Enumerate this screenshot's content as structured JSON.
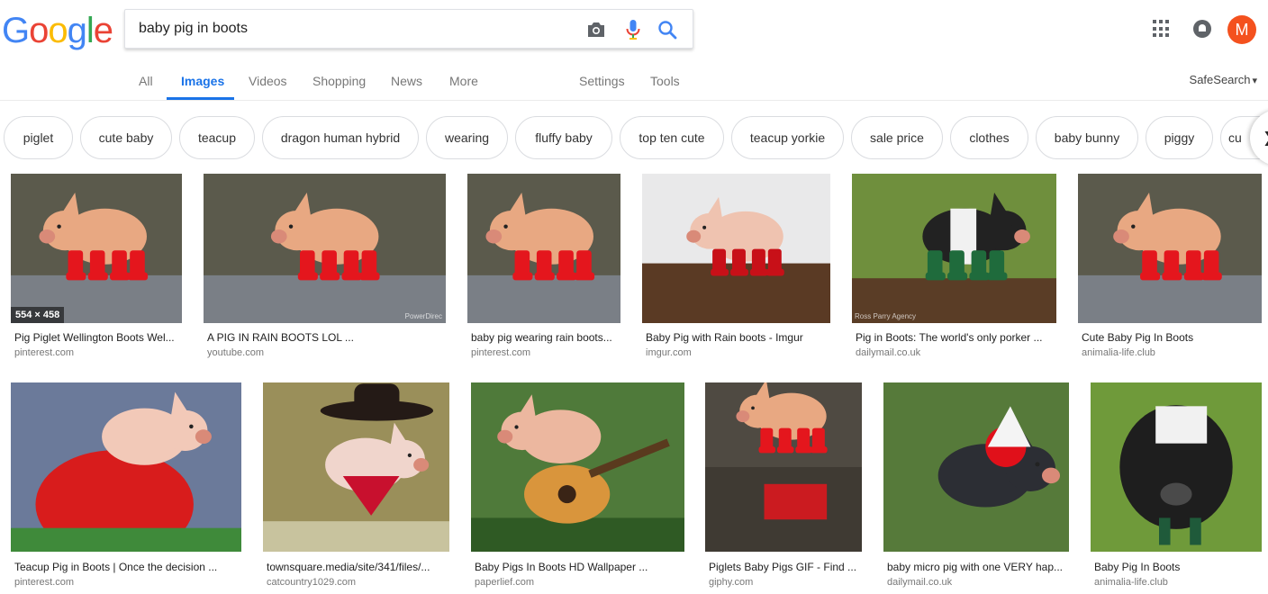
{
  "logo": [
    "G",
    "o",
    "o",
    "g",
    "l",
    "e"
  ],
  "search": {
    "query": "baby pig in boots"
  },
  "avatar_letter": "M",
  "tabs": [
    {
      "label": "All"
    },
    {
      "label": "Images"
    },
    {
      "label": "Videos"
    },
    {
      "label": "Shopping"
    },
    {
      "label": "News"
    },
    {
      "label": "More"
    },
    {
      "label": "Settings"
    },
    {
      "label": "Tools"
    }
  ],
  "safesearch_label": "SafeSearch",
  "chips": [
    "piglet",
    "cute baby",
    "teacup",
    "dragon human hybrid",
    "wearing",
    "fluffy baby",
    "top ten cute",
    "teacup yorkie",
    "sale price",
    "clothes",
    "baby bunny",
    "piggy",
    "cu"
  ],
  "results": [
    {
      "title": "Pig Piglet Wellington Boots Wel...",
      "domain": "pinterest.com",
      "dims": "554 × 458",
      "watermark": ""
    },
    {
      "title": "A PIG IN RAIN BOOTS LOL ...",
      "domain": "youtube.com",
      "watermark": "PowerDirec"
    },
    {
      "title": "baby pig wearing rain boots...",
      "domain": "pinterest.com"
    },
    {
      "title": "Baby Pig with Rain boots - Imgur",
      "domain": "imgur.com"
    },
    {
      "title": "Pig in Boots: The world's only porker ...",
      "domain": "dailymail.co.uk",
      "watermark": "Ross Parry Agency"
    },
    {
      "title": "Cute Baby Pig In Boots",
      "domain": "animalia-life.club"
    },
    {
      "title": "Teacup Pig in Boots | Once the decision ...",
      "domain": "pinterest.com"
    },
    {
      "title": "townsquare.media/site/341/files/...",
      "domain": "catcountry1029.com"
    },
    {
      "title": "Baby Pigs In Boots HD Wallpaper ...",
      "domain": "paperlief.com"
    },
    {
      "title": "Piglets Baby Pigs GIF - Find ...",
      "domain": "giphy.com"
    },
    {
      "title": "baby micro pig with one VERY hap...",
      "domain": "dailymail.co.uk"
    },
    {
      "title": "Baby Pig In Boots",
      "domain": "animalia-life.club"
    }
  ],
  "colors": {
    "link_blue": "#1a73e8",
    "avatar": "#f4511e",
    "boot_red": "#e4161d",
    "pig_pink": "#e8a882"
  }
}
